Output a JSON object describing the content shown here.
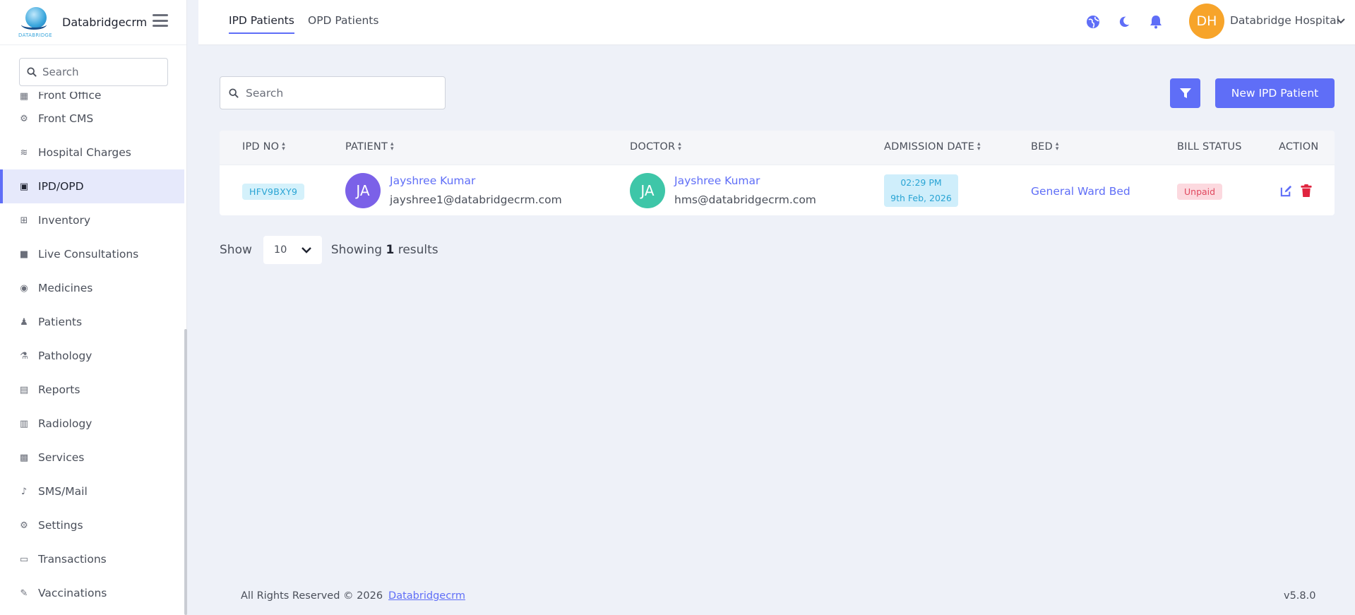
{
  "brand": {
    "name": "Databridgecrm",
    "logo_text": "DATABRIDGE"
  },
  "sidebar": {
    "search_placeholder": "Search",
    "items": [
      {
        "label": "Front Office",
        "icon": "front-office-icon"
      },
      {
        "label": "Front CMS",
        "icon": "gear-icon"
      },
      {
        "label": "Hospital Charges",
        "icon": "coins-icon"
      },
      {
        "label": "IPD/OPD",
        "icon": "clipboard-icon",
        "active": true
      },
      {
        "label": "Inventory",
        "icon": "cart-icon"
      },
      {
        "label": "Live Consultations",
        "icon": "video-icon"
      },
      {
        "label": "Medicines",
        "icon": "capsules-icon"
      },
      {
        "label": "Patients",
        "icon": "user-injured-icon"
      },
      {
        "label": "Pathology",
        "icon": "flask-icon"
      },
      {
        "label": "Reports",
        "icon": "file-icon"
      },
      {
        "label": "Radiology",
        "icon": "xray-icon"
      },
      {
        "label": "Services",
        "icon": "calendar-icon"
      },
      {
        "label": "SMS/Mail",
        "icon": "bell-icon"
      },
      {
        "label": "Settings",
        "icon": "cogs-icon"
      },
      {
        "label": "Transactions",
        "icon": "money-icon"
      },
      {
        "label": "Vaccinations",
        "icon": "syringe-icon"
      }
    ]
  },
  "topbar": {
    "tabs": [
      {
        "label": "IPD Patients",
        "active": true
      },
      {
        "label": "OPD Patients",
        "active": false
      }
    ],
    "icons": [
      "globe-icon",
      "moon-icon",
      "bell-icon"
    ],
    "user": {
      "initials": "DH",
      "name": "Databridge Hospital"
    }
  },
  "main": {
    "search_placeholder": "Search",
    "new_button": "New IPD Patient",
    "columns": [
      "IPD NO",
      "PATIENT",
      "DOCTOR",
      "ADMISSION DATE",
      "BED",
      "BILL STATUS",
      "ACTION"
    ],
    "rows": [
      {
        "ipd_no": "HFV9BXY9",
        "patient": {
          "initials": "JA",
          "name": "Jayshree Kumar",
          "email": "jayshree1@databridgecrm.com"
        },
        "doctor": {
          "initials": "JA",
          "name": "Jayshree Kumar",
          "email": "hms@databridgecrm.com"
        },
        "admission_time": "02:29 PM",
        "admission_date": "9th Feb, 2026",
        "bed": "General Ward Bed",
        "bill_status": "Unpaid"
      }
    ],
    "pagination": {
      "show_label": "Show",
      "per_page": "10",
      "showing_prefix": "Showing",
      "count": "1",
      "showing_suffix": "results"
    }
  },
  "footer": {
    "copyright": "All Rights Reserved © 2026",
    "link": "Databridgecrm",
    "version": "v5.8.0"
  },
  "colors": {
    "accent": "#5f6ef7",
    "patient_avatar": "#7b61e8",
    "doctor_avatar": "#3ec6a8",
    "user_avatar": "#f7a42a",
    "unpaid": "#e0485e"
  }
}
